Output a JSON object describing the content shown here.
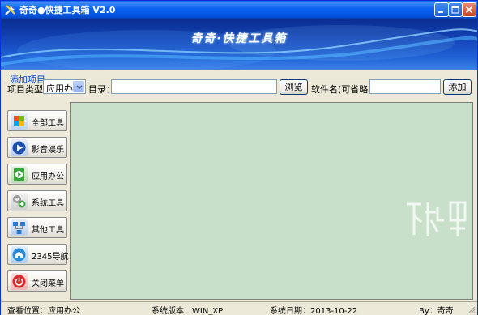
{
  "window": {
    "title": "奇奇●快捷工具箱 V2.0"
  },
  "banner": {
    "title": "奇奇·快捷工具箱"
  },
  "add_item": {
    "group_label": "添加项目",
    "type_label": "项目类型:",
    "type_value": "应用办公",
    "dir_label": "目录：",
    "dir_value": "",
    "browse_label": "浏览",
    "name_label": "软件名(可省略)：",
    "name_value": "",
    "add_label": "添加"
  },
  "nav": [
    {
      "label": "全部工具",
      "icon": "windows-logo-icon",
      "color": "#3a7bd5"
    },
    {
      "label": "影音娱乐",
      "icon": "play-icon",
      "color": "#2a64c8"
    },
    {
      "label": "应用办公",
      "icon": "document-play-icon",
      "color": "#3aa53a"
    },
    {
      "label": "系统工具",
      "icon": "gears-icon",
      "color": "#8a8a8a"
    },
    {
      "label": "其他工具",
      "icon": "network-icon",
      "color": "#2a7ad0"
    },
    {
      "label": "2345导航",
      "icon": "home-icon",
      "color": "#2b8ad8"
    },
    {
      "label": "关闭菜单",
      "icon": "power-icon",
      "color": "#d62b2b"
    }
  ],
  "status": {
    "location": "查看位置：应用办公",
    "version": "系统版本：WIN_XP",
    "date": "系统日期：2013-10-22",
    "author": "By：奇奇"
  },
  "watermark": {
    "text": "下载吧"
  },
  "colors": {
    "titlebar": "#0553e0",
    "content_bg": "#c8dfc9",
    "accent": "#0046d5"
  }
}
